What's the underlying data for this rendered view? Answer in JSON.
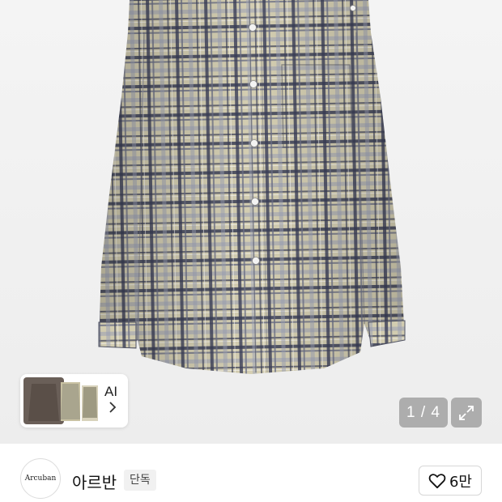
{
  "gallery": {
    "ai_label": "AI",
    "counter": "1 / 4",
    "image_icon": "checked-shirt-product-image",
    "similar_icon": "chevron-right-icon",
    "expand_icon": "expand-icon"
  },
  "brand": {
    "logo_text": "Arcuban",
    "name": "아르반",
    "badge": "단독"
  },
  "like": {
    "icon": "heart-icon",
    "count": "6만"
  },
  "colors": {
    "background": "#ffffff",
    "overlay": "#787878",
    "shirt_base": "#cfc7a8",
    "shirt_navy": "#3a3f55",
    "shirt_grey": "#8c8f9c"
  }
}
